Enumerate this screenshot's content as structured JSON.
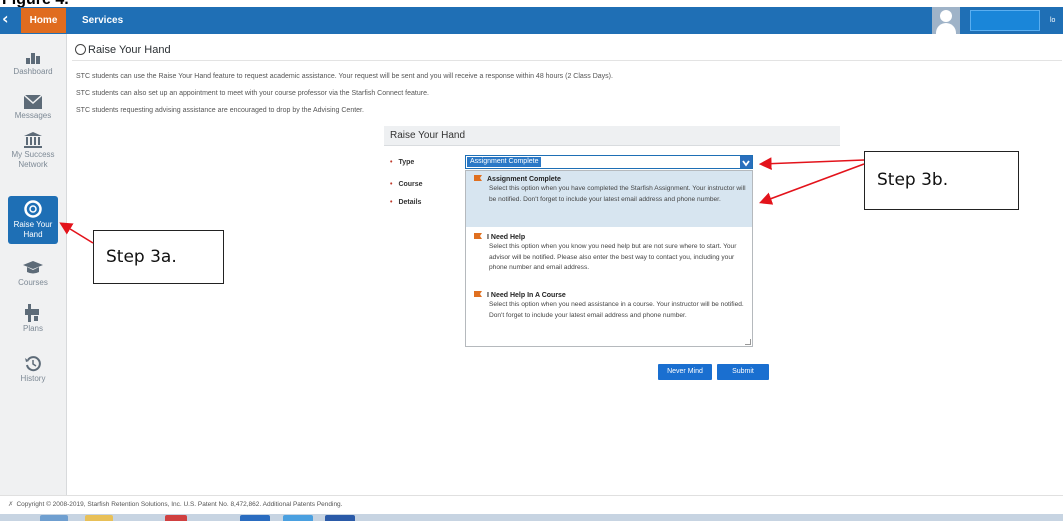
{
  "figure": {
    "caption": "Figure 4."
  },
  "topbar": {
    "close_glyph": "‹",
    "home_label": "Home",
    "services_label": "Services",
    "right_text": "lo",
    "bg_color": "#1f6fb5",
    "home_color": "#e06c1f"
  },
  "sidebar": {
    "items": [
      {
        "label": "Dashboard",
        "icon": "dashboard-icon"
      },
      {
        "label": "Messages",
        "icon": "envelope-icon"
      },
      {
        "label": "My Success Network",
        "icon": "bank-icon"
      },
      {
        "label": "Raise Your Hand",
        "icon": "life-ring-icon",
        "active": true
      },
      {
        "label": "Courses",
        "icon": "graduation-cap-icon"
      },
      {
        "label": "Plans",
        "icon": "plans-icon"
      },
      {
        "label": "History",
        "icon": "history-icon"
      }
    ]
  },
  "page": {
    "title": "Raise Your Hand",
    "intro": [
      "STC students can use the Raise Your Hand feature to request academic assistance.  Your request will be sent and you will receive a response within 48 hours (2 Class Days).",
      "STC students can also set up an appointment to meet with your course professor via the Starfish Connect feature.",
      "STC students requesting advising assistance are encouraged to drop by the Advising Center."
    ]
  },
  "form": {
    "panel_title": "Raise Your Hand",
    "fields": {
      "type": "Type",
      "course": "Course",
      "details": "Details"
    },
    "type_select": {
      "selected": "Assignment Complete"
    },
    "options": [
      {
        "title": "Assignment Complete",
        "description": "Select this option when you have completed the Starfish Assignment. Your instructor will be notified. Don't forget to include your latest email address and phone number.",
        "highlighted": true
      },
      {
        "title": "I Need Help",
        "description": "Select this option when you know you need help but are not sure where to start. Your advisor will be notified. Please also enter the best way to contact you, including your phone number and email address.",
        "highlighted": false
      },
      {
        "title": "I Need Help In A Course",
        "description": "Select this option when you need assistance in a course. Your instructor will be notified. Don't forget to include your latest email address and phone number.",
        "highlighted": false
      }
    ],
    "buttons": {
      "never_mind": "Never Mind",
      "submit": "Submit"
    }
  },
  "footer": {
    "mark": "✗",
    "text": "Copyright © 2008-2019, Starfish Retention Solutions, Inc. U.S. Patent No. 8,472,862. Additional Patents Pending."
  },
  "annotations": {
    "step_3a": "Step 3a.",
    "step_3b": "Step 3b.",
    "arrow_color": "#e3131b"
  }
}
